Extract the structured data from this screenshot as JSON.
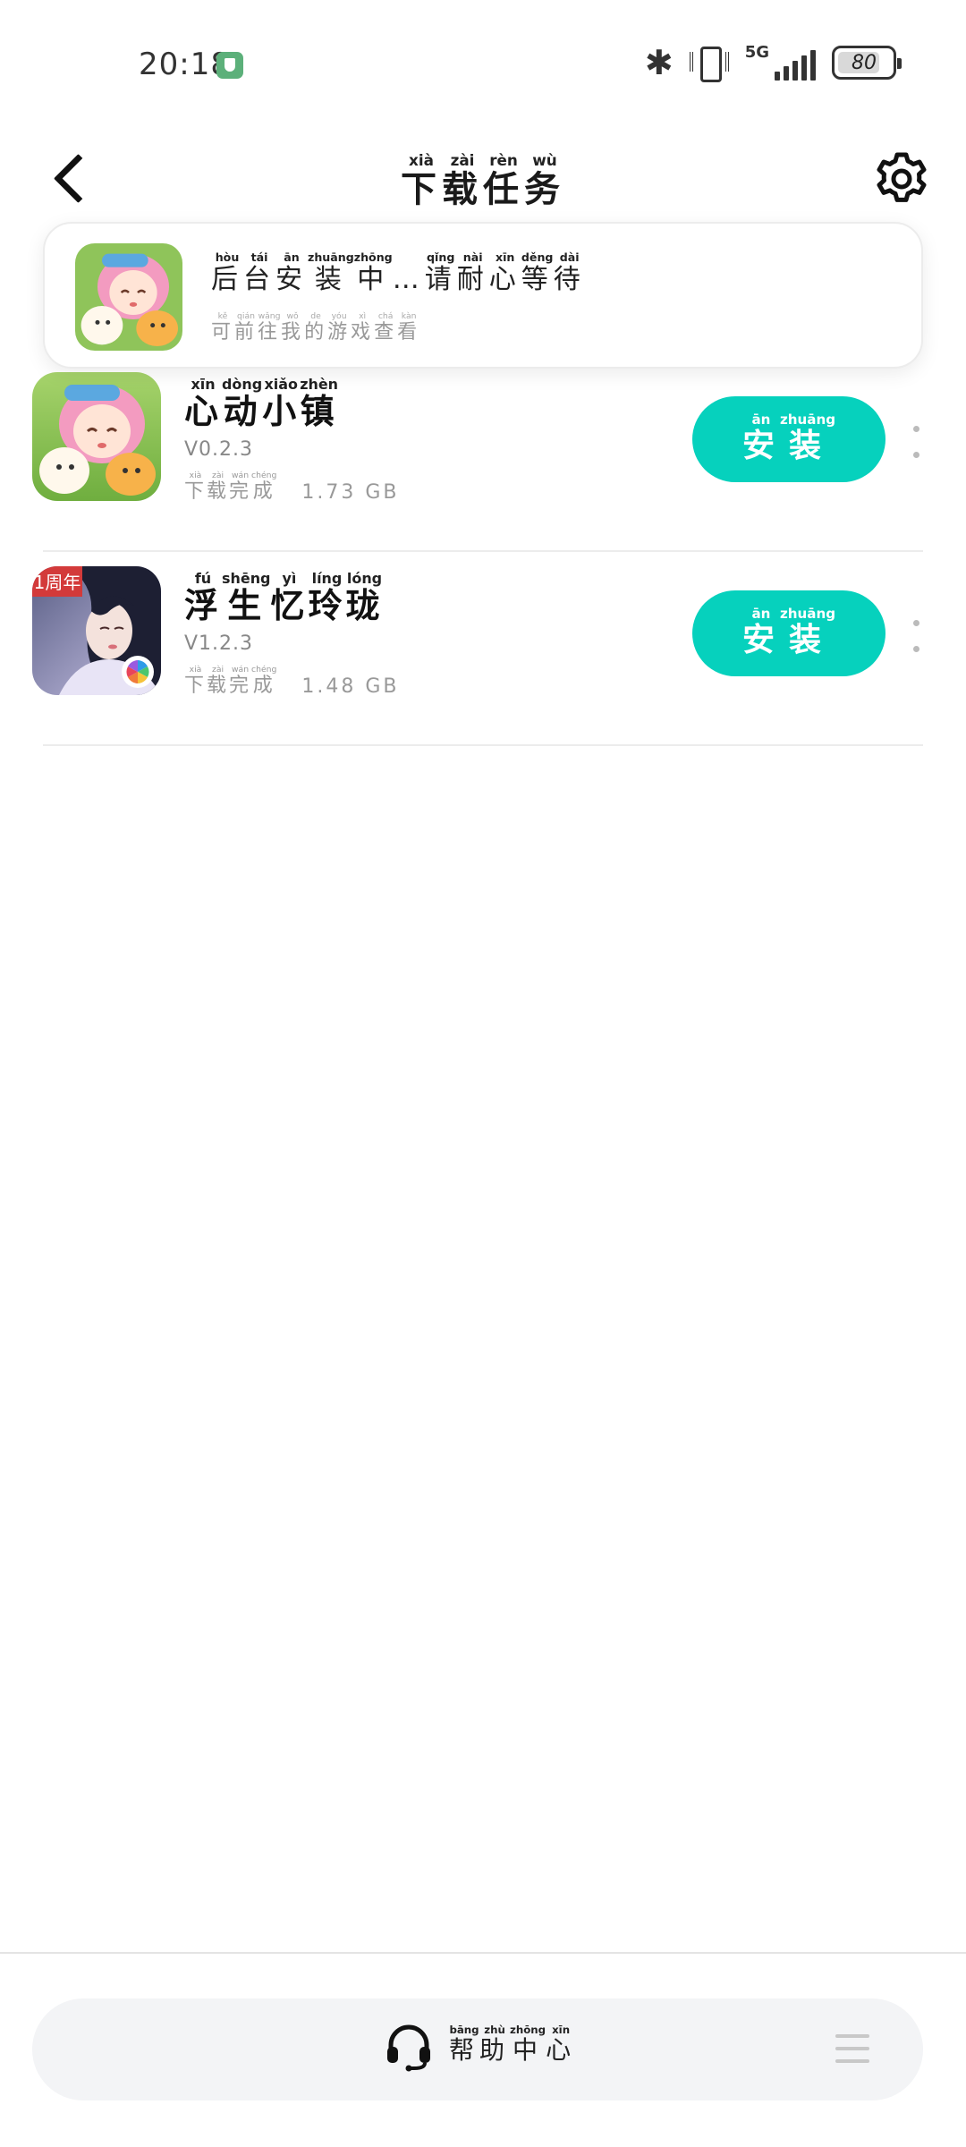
{
  "status_bar": {
    "time": "20:18",
    "network": "5G",
    "battery": "80",
    "battery_level": 0.8,
    "icons": [
      "shield-icon",
      "bluetooth-icon",
      "vibrate-icon",
      "signal-icon",
      "battery-icon"
    ]
  },
  "header": {
    "title": [
      {
        "ch": "下",
        "py": "xià"
      },
      {
        "ch": "载",
        "py": "zài"
      },
      {
        "ch": "任",
        "py": "rèn"
      },
      {
        "ch": "务",
        "py": "wù"
      }
    ]
  },
  "toast": {
    "title": [
      {
        "ch": "后",
        "py": "hòu"
      },
      {
        "ch": "台",
        "py": "tái"
      },
      {
        "ch": "安",
        "py": "ān"
      },
      {
        "ch": "装",
        "py": "zhuāng"
      },
      {
        "ch": "中",
        "py": "zhōng"
      },
      {
        "ch": "…",
        "py": ""
      },
      {
        "ch": "请",
        "py": "qǐng"
      },
      {
        "ch": "耐",
        "py": "nài"
      },
      {
        "ch": "心",
        "py": "xīn"
      },
      {
        "ch": "等",
        "py": "děng"
      },
      {
        "ch": "待",
        "py": "dài"
      }
    ],
    "subtitle": [
      {
        "ch": "可",
        "py": "kě"
      },
      {
        "ch": "前",
        "py": "qián"
      },
      {
        "ch": "往",
        "py": "wǎng"
      },
      {
        "ch": "我",
        "py": "wǒ"
      },
      {
        "ch": "的",
        "py": "de"
      },
      {
        "ch": "游",
        "py": "yóu"
      },
      {
        "ch": "戏",
        "py": "xì"
      },
      {
        "ch": "查",
        "py": "chá"
      },
      {
        "ch": "看",
        "py": "kàn"
      }
    ]
  },
  "downloads": [
    {
      "name": [
        {
          "ch": "心",
          "py": "xīn"
        },
        {
          "ch": "动",
          "py": "dòng"
        },
        {
          "ch": "小",
          "py": "xiǎo"
        },
        {
          "ch": "镇",
          "py": "zhèn"
        }
      ],
      "version": "V0.2.3",
      "status": [
        {
          "ch": "下",
          "py": "xià"
        },
        {
          "ch": "载",
          "py": "zài"
        },
        {
          "ch": "完",
          "py": "wán"
        },
        {
          "ch": "成",
          "py": "chéng"
        }
      ],
      "size": "1.73 GB",
      "button": [
        {
          "ch": "安",
          "py": "ān"
        },
        {
          "ch": "装",
          "py": "zhuāng"
        }
      ]
    },
    {
      "name": [
        {
          "ch": "浮",
          "py": "fú"
        },
        {
          "ch": "生",
          "py": "shēng"
        },
        {
          "ch": "忆",
          "py": "yì"
        },
        {
          "ch": "玲",
          "py": "líng"
        },
        {
          "ch": "珑",
          "py": "lóng"
        }
      ],
      "version": "V1.2.3",
      "status": [
        {
          "ch": "下",
          "py": "xià"
        },
        {
          "ch": "载",
          "py": "zài"
        },
        {
          "ch": "完",
          "py": "wán"
        },
        {
          "ch": "成",
          "py": "chéng"
        }
      ],
      "size": "1.48 GB",
      "badge": "1周年",
      "button": [
        {
          "ch": "安",
          "py": "ān"
        },
        {
          "ch": "装",
          "py": "zhuāng"
        }
      ]
    }
  ],
  "footer": {
    "help_label": [
      {
        "ch": "帮",
        "py": "bāng"
      },
      {
        "ch": "助",
        "py": "zhù"
      },
      {
        "ch": "中",
        "py": "zhōng"
      },
      {
        "ch": "心",
        "py": "xīn"
      }
    ],
    "help_icon": "headset-icon",
    "menu_icon": "menu-icon"
  },
  "colors": {
    "accent": "#06d1bd",
    "secure_badge": "#5cb07a"
  }
}
